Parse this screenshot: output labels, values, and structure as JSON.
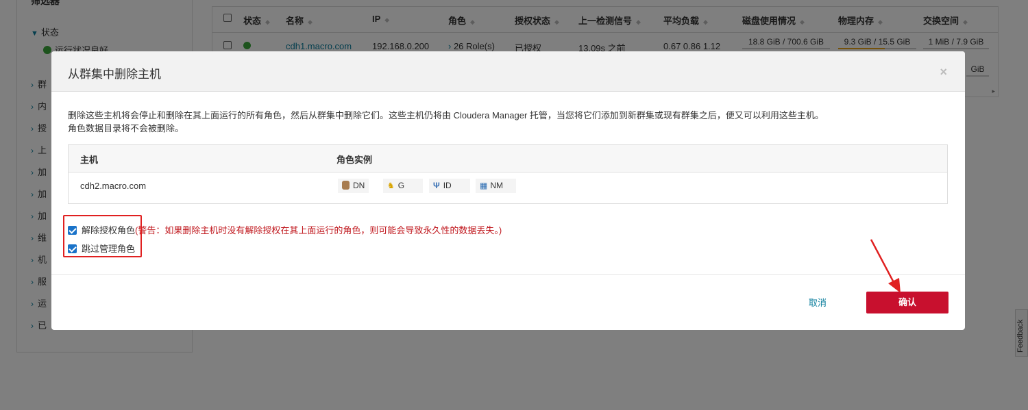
{
  "sidebar": {
    "heading": "筛选器",
    "status_label": "状态",
    "running_label": "运行状况良好",
    "items": [
      "群",
      "内",
      "授",
      "上",
      "加",
      "加",
      "加",
      "维",
      "机",
      "服",
      "运",
      "已"
    ]
  },
  "bg_table": {
    "headers": [
      "状态",
      "名称",
      "IP",
      "角色",
      "授权状态",
      "上一检测信号",
      "平均负载",
      "磁盘使用情况",
      "物理内存",
      "交换空间"
    ],
    "row": {
      "name": "cdh1.macro.com",
      "ip": "192.168.0.200",
      "roles": "26 Role(s)",
      "auth": "已授权",
      "heartbeat": "13.09s 之前",
      "load": "0.67  0.86  1.12",
      "disk": "18.8 GiB / 700.6 GiB",
      "memory": "9.3 GiB / 15.5 GiB",
      "memory_fraction": 0.6,
      "swap": "1 MiB / 7.9 GiB",
      "swap2_tail": "GiB"
    }
  },
  "feedback_label": "Feedback",
  "modal": {
    "title": "从群集中删除主机",
    "close_glyph": "×",
    "description_line1": "删除这些主机将会停止和删除在其上面运行的所有角色，然后从群集中删除它们。这些主机仍将由 Cloudera Manager 托管，当您将它们添加到新群集或现有群集之后，便又可以利用这些主机。",
    "description_line2": "角色数据目录将不会被删除。",
    "table": {
      "col_host": "主机",
      "col_roles": "角色实例",
      "host": "cdh2.macro.com",
      "roles": [
        "DN",
        "G",
        "ID",
        "NM"
      ]
    },
    "options": {
      "decommission_label": "解除授权角色",
      "decommission_warning": "(警告：如果删除主机时没有解除授权在其上面运行的角色，则可能会导致永久性的数据丢失。)",
      "skip_mgmt_label": "跳过管理角色"
    },
    "cancel_label": "取消",
    "confirm_label": "确认"
  },
  "colors": {
    "accent_red": "#c8102e",
    "link": "#0a7d9c",
    "warning": "#c0171d",
    "checkbox": "#1a73c9",
    "annotation": "#e02020"
  }
}
